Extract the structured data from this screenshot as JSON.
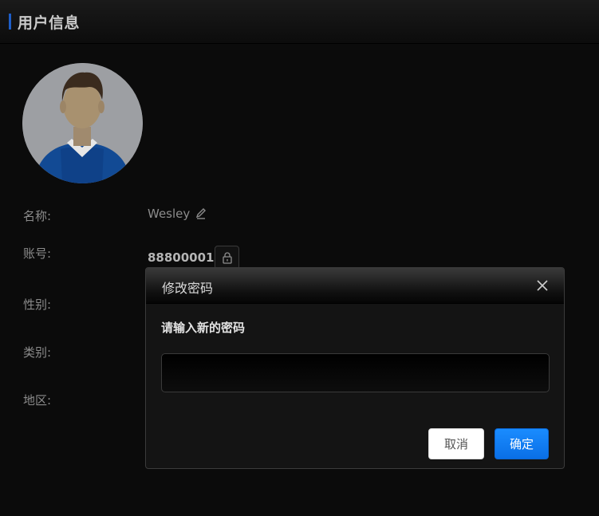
{
  "header": {
    "title": "用户信息"
  },
  "profile": {
    "fields": [
      {
        "label": "名称:",
        "value": "Wesley"
      },
      {
        "label": "账号:",
        "value": "88800001"
      },
      {
        "label": "性别:",
        "value": ""
      },
      {
        "label": "类别:",
        "value": ""
      },
      {
        "label": "地区:",
        "value": ""
      }
    ]
  },
  "icons": {
    "edit": "pencil-icon",
    "lock": "lock-icon",
    "close": "close-icon"
  },
  "dialog": {
    "title": "修改密码",
    "prompt": "请输入新的密码",
    "input_value": "",
    "cancel_label": "取消",
    "ok_label": "确定"
  },
  "colors": {
    "accent": "#1e5ec8",
    "primary_button": "#0a78f0",
    "background": "#0b0b0b"
  }
}
